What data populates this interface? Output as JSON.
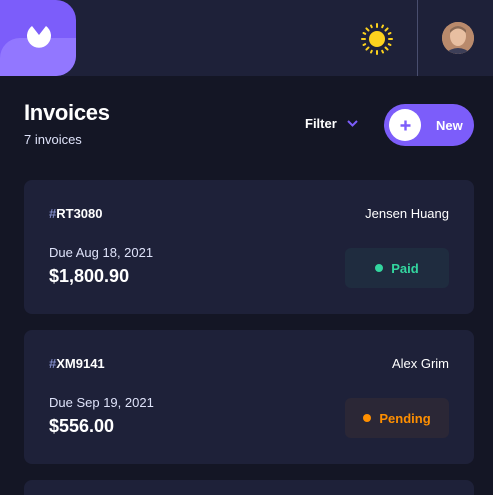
{
  "header": {
    "logo_icon": "app-logo",
    "theme_icon": "sun-icon",
    "avatar_icon": "user-avatar",
    "colors": {
      "accent": "#7c5dfa",
      "accent_light": "#9277ff",
      "sun": "#fcd21e"
    }
  },
  "title": {
    "heading": "Invoices",
    "count": "7 invoices"
  },
  "toolbar": {
    "filter_label": "Filter",
    "new_label": "New"
  },
  "invoices": [
    {
      "hash": "#",
      "id": "RT3080",
      "client": "Jensen Huang",
      "due": "Due Aug 18, 2021",
      "amount": "$1,800.90",
      "status": "Paid",
      "status_color": "#33d69f"
    },
    {
      "hash": "#",
      "id": "XM9141",
      "client": "Alex Grim",
      "due": "Due Sep 19, 2021",
      "amount": "$556.00",
      "status": "Pending",
      "status_color": "#ff8f00"
    }
  ]
}
